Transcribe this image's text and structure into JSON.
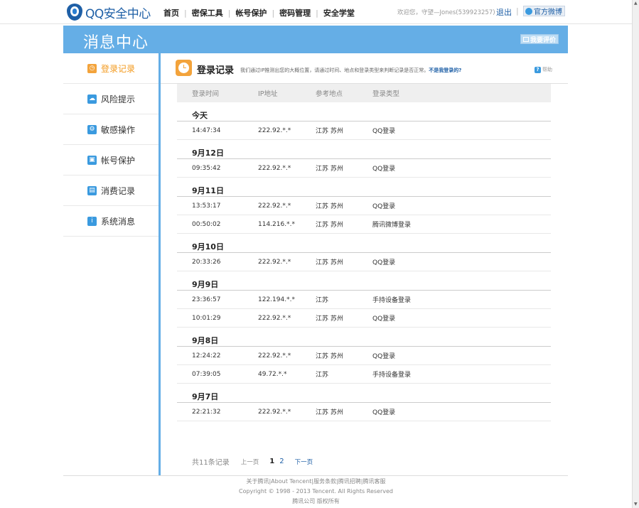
{
  "header": {
    "logo_text": "QQ安全中心",
    "nav": [
      "首页",
      "密保工具",
      "帐号保护",
      "密码管理",
      "安全学堂"
    ],
    "welcome": "欢迎您，守望—Jones(539923257)",
    "logout": "退出",
    "weibo": "官方微博"
  },
  "band": {
    "title": "消息中心",
    "feedback": "我要评价"
  },
  "sidebar": {
    "items": [
      {
        "label": "登录记录",
        "icon": "clock-icon",
        "color": "#f3a33b"
      },
      {
        "label": "风险提示",
        "icon": "cloud-icon",
        "color": "#3a9adf"
      },
      {
        "label": "敏感操作",
        "icon": "gear-icon",
        "color": "#3a9adf"
      },
      {
        "label": "帐号保护",
        "icon": "lock-icon",
        "color": "#3a9adf"
      },
      {
        "label": "消费记录",
        "icon": "cart-icon",
        "color": "#3a9adf"
      },
      {
        "label": "系统消息",
        "icon": "info-icon",
        "color": "#3a9adf"
      }
    ]
  },
  "main": {
    "title": "登录记录",
    "desc": "我们通过IP推测出您的大概位置，请通过时间、地点和登录类型来判断记录是否正常。",
    "notme": "不是我登录的?",
    "help": "帮助"
  },
  "table": {
    "headers": [
      "登录时间",
      "IP地址",
      "参考地点",
      "登录类型"
    ],
    "groups": [
      {
        "date": "今天",
        "rows": [
          [
            "14:47:34",
            "222.92.*.*",
            "江苏 苏州",
            "QQ登录"
          ]
        ]
      },
      {
        "date": "9月12日",
        "rows": [
          [
            "09:35:42",
            "222.92.*.*",
            "江苏 苏州",
            "QQ登录"
          ]
        ]
      },
      {
        "date": "9月11日",
        "rows": [
          [
            "13:53:17",
            "222.92.*.*",
            "江苏 苏州",
            "QQ登录"
          ],
          [
            "00:50:02",
            "114.216.*.*",
            "江苏 苏州",
            "腾讯微博登录"
          ]
        ]
      },
      {
        "date": "9月10日",
        "rows": [
          [
            "20:33:26",
            "222.92.*.*",
            "江苏 苏州",
            "QQ登录"
          ]
        ]
      },
      {
        "date": "9月9日",
        "rows": [
          [
            "23:36:57",
            "122.194.*.*",
            "江苏",
            "手持设备登录"
          ],
          [
            "10:01:29",
            "222.92.*.*",
            "江苏 苏州",
            "QQ登录"
          ]
        ]
      },
      {
        "date": "9月8日",
        "rows": [
          [
            "12:24:22",
            "222.92.*.*",
            "江苏 苏州",
            "QQ登录"
          ],
          [
            "07:39:05",
            "49.72.*.*",
            "江苏",
            "手持设备登录"
          ]
        ]
      },
      {
        "date": "9月7日",
        "rows": [
          [
            "22:21:32",
            "222.92.*.*",
            "江苏 苏州",
            "QQ登录"
          ]
        ]
      }
    ]
  },
  "pager": {
    "total": "共11条记录",
    "prev": "上一页",
    "current": "1",
    "page2": "2",
    "next": "下一页"
  },
  "footer": {
    "links": "关于腾讯|About Tencent|服务条款|腾讯招聘|腾讯客服",
    "copyright": "Copyright © 1998 - 2013 Tencent. All Rights Reserved",
    "company": "腾讯公司 版权所有"
  }
}
